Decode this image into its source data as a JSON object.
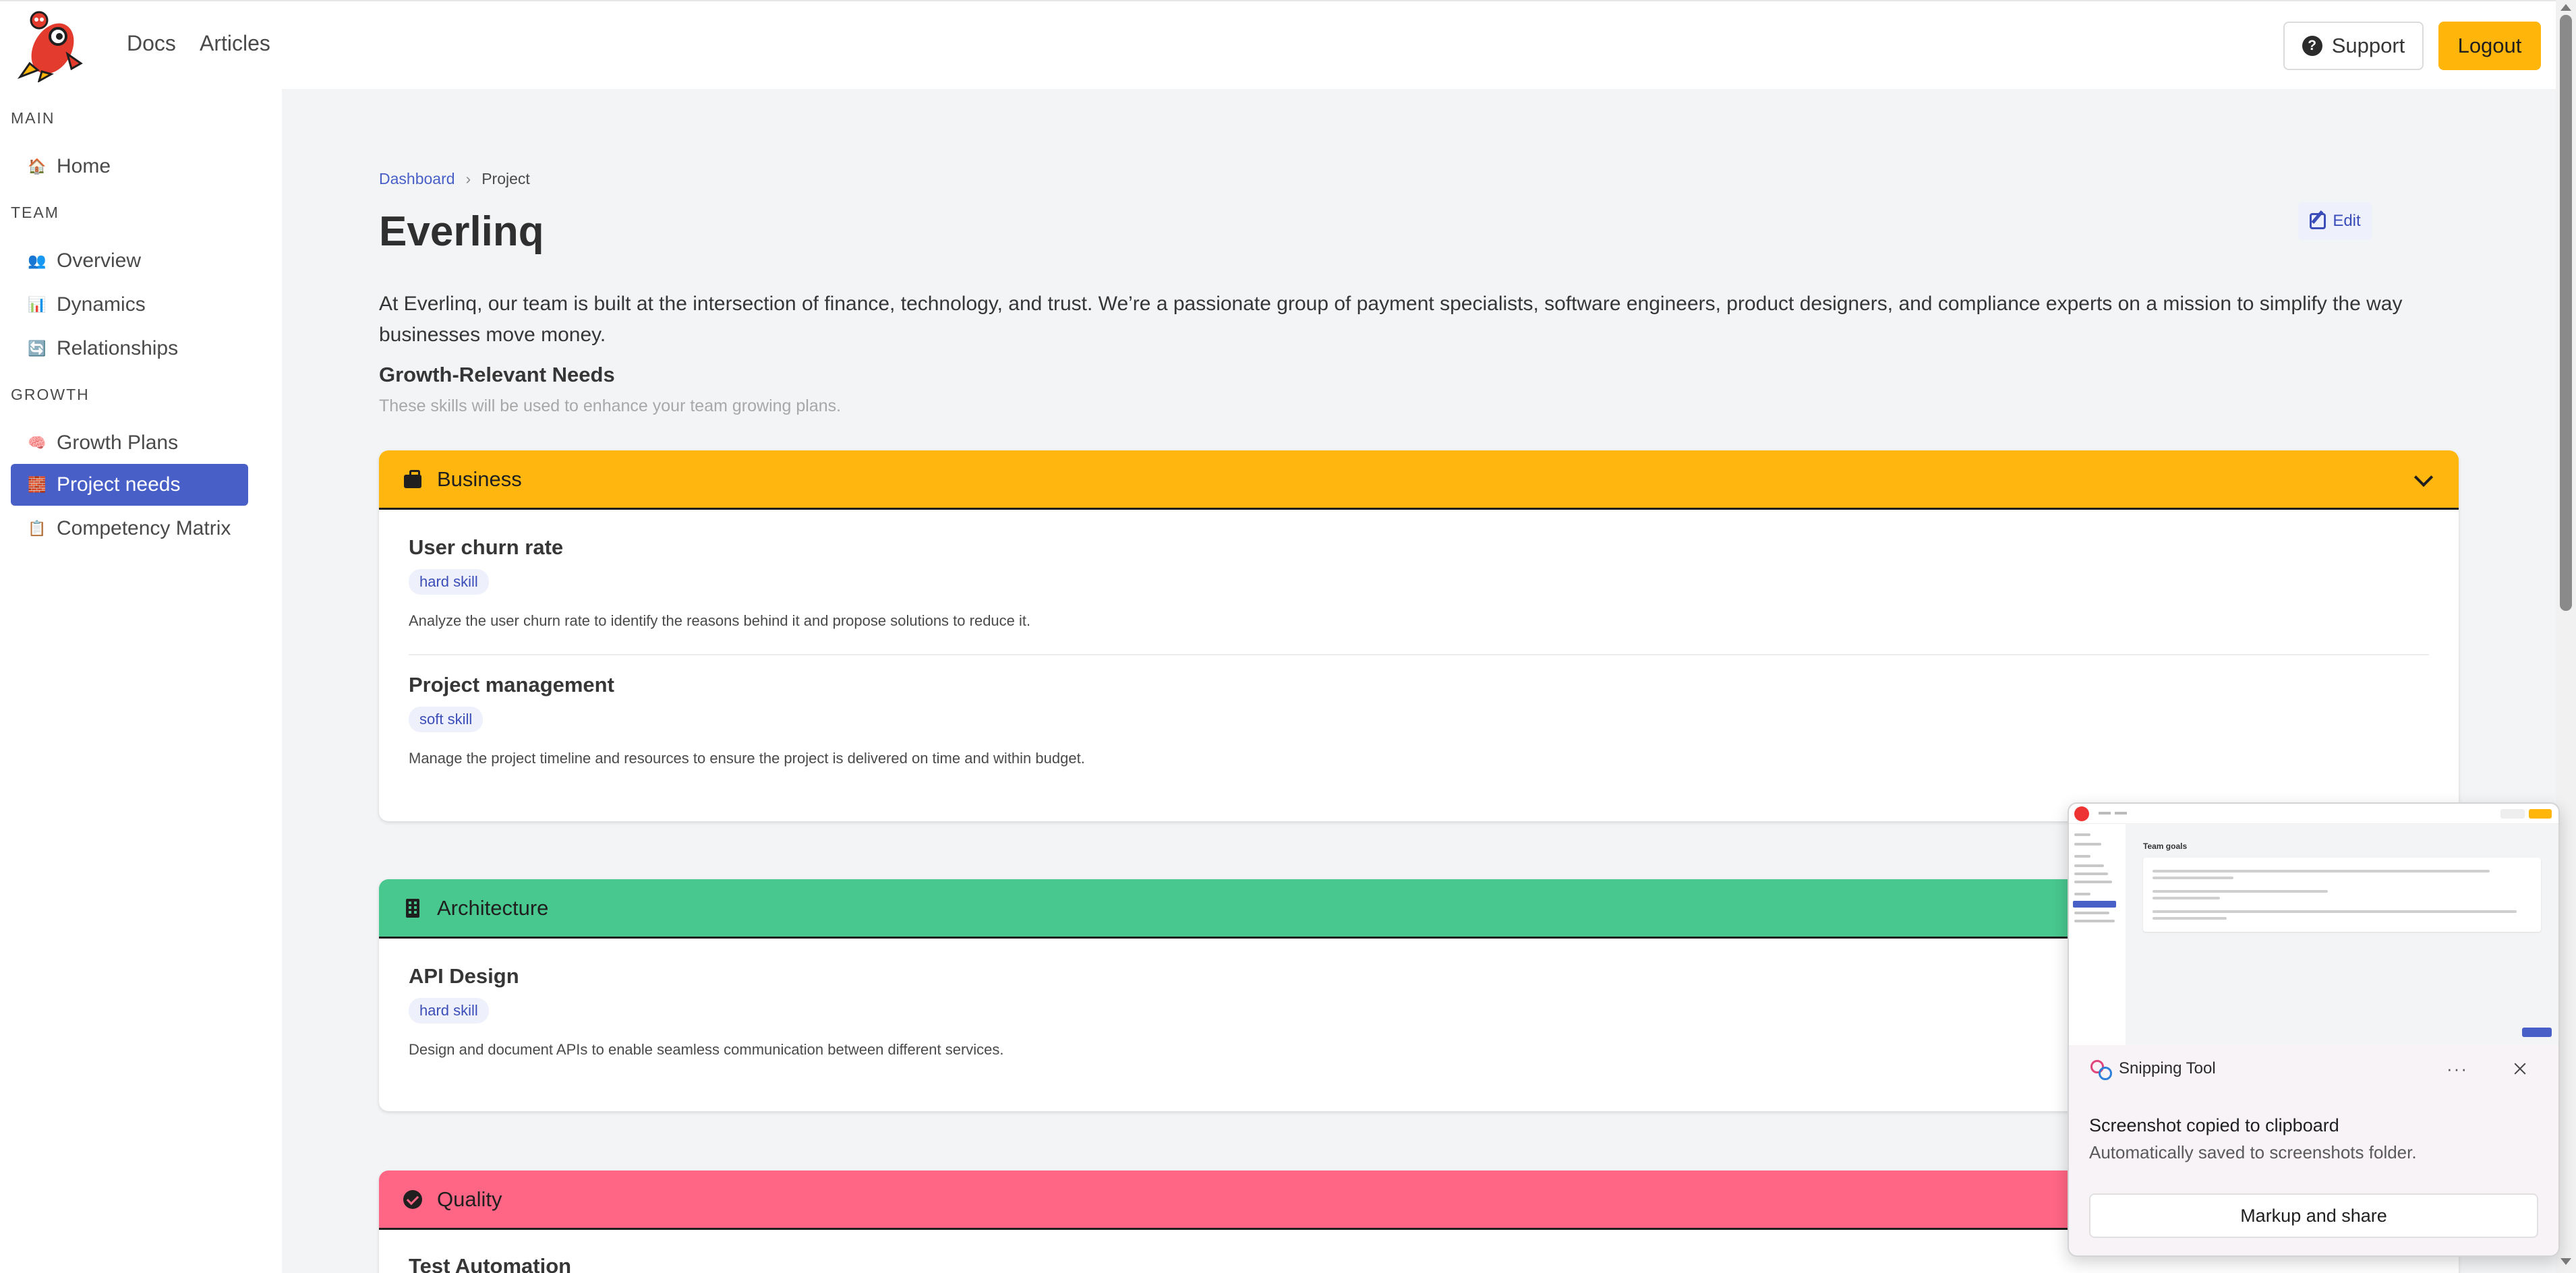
{
  "navbar": {
    "links": [
      "Docs",
      "Articles"
    ],
    "support_label": "Support",
    "logout_label": "Logout",
    "accent_color": "#ffb50a"
  },
  "sidebar": {
    "sections": [
      {
        "label": "MAIN",
        "items": [
          {
            "label": "Home",
            "icon": "house-icon"
          }
        ]
      },
      {
        "label": "TEAM",
        "items": [
          {
            "label": "Overview",
            "icon": "people-icon"
          },
          {
            "label": "Dynamics",
            "icon": "bar-chart-icon"
          },
          {
            "label": "Relationships",
            "icon": "cycle-icon"
          }
        ]
      },
      {
        "label": "GROWTH",
        "items": [
          {
            "label": "Growth Plans",
            "icon": "brain-icon"
          },
          {
            "label": "Project needs",
            "icon": "bricks-icon",
            "active": true
          },
          {
            "label": "Competency Matrix",
            "icon": "clipboard-icon"
          }
        ]
      }
    ],
    "active_color": "#485fc7"
  },
  "breadcrumb": {
    "items": [
      "Dashboard",
      "Project"
    ],
    "separator": "›"
  },
  "page": {
    "title": "Everlinq",
    "edit_label": "Edit",
    "description": "At Everlinq, our team is built at the intersection of finance, technology, and trust. We’re a passionate group of payment specialists, software engineers, product designers, and compliance experts on a mission to simplify the way businesses move money.",
    "needs_heading": "Growth-Relevant Needs",
    "needs_subtitle": "These skills will be used to enhance your team growing plans."
  },
  "categories": [
    {
      "name": "Business",
      "color": "#ffb70f",
      "icon": "briefcase-icon",
      "skills": [
        {
          "title": "User churn rate",
          "tag": "hard skill",
          "description": "Analyze the user churn rate to identify the reasons behind it and propose solutions to reduce it."
        },
        {
          "title": "Project management",
          "tag": "soft skill",
          "description": "Manage the project timeline and resources to ensure the project is delivered on time and within budget."
        }
      ]
    },
    {
      "name": "Architecture",
      "color": "#48c78e",
      "icon": "building-icon",
      "skills": [
        {
          "title": "API Design",
          "tag": "hard skill",
          "description": "Design and document APIs to enable seamless communication between different services."
        }
      ]
    },
    {
      "name": "Quality",
      "color": "#ff6685",
      "icon": "check-circle-icon",
      "skills": [
        {
          "title": "Test Automation",
          "tag": "",
          "description": ""
        }
      ]
    }
  ],
  "snipping_tool": {
    "app_name": "Snipping Tool",
    "more_label": "···",
    "message": "Screenshot copied to clipboard",
    "submessage": "Automatically saved to screenshots folder.",
    "button_label": "Markup and share",
    "thumbnail_title": "Team goals"
  }
}
